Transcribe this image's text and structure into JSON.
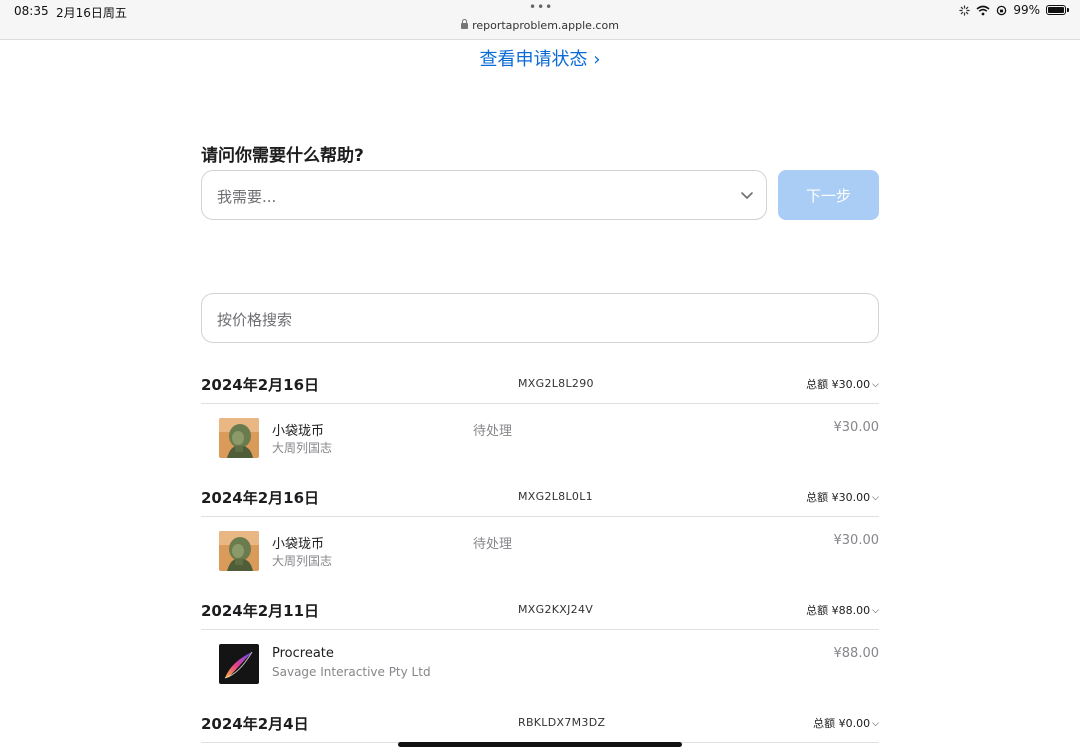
{
  "statusbar": {
    "time": "08:35",
    "date": "2月16日周五",
    "dots": "•••",
    "url": "reportaproblem.apple.com",
    "battery": "99%"
  },
  "status_link": "查看申请状态 ›",
  "help": {
    "question": "请问你需要什么帮助?",
    "select_placeholder": "我需要...",
    "next_label": "下一步"
  },
  "search": {
    "placeholder": "按价格搜索"
  },
  "orders": [
    {
      "date": "2024年2月16日",
      "order_id": "MXG2L8L290",
      "total": "总额 ¥30.00",
      "item": {
        "title": "小袋珑币",
        "subtitle": "大周列国志",
        "status": "待处理",
        "price": "¥30.00",
        "icon": "game-character-icon"
      }
    },
    {
      "date": "2024年2月16日",
      "order_id": "MXG2L8L0L1",
      "total": "总额 ¥30.00",
      "item": {
        "title": "小袋珑币",
        "subtitle": "大周列国志",
        "status": "待处理",
        "price": "¥30.00",
        "icon": "game-character-icon"
      }
    },
    {
      "date": "2024年2月11日",
      "order_id": "MXG2KXJ24V",
      "total": "总额 ¥88.00",
      "item": {
        "title": "Procreate",
        "subtitle": "Savage Interactive Pty Ltd",
        "status": "",
        "price": "¥88.00",
        "icon": "procreate-app-icon"
      }
    },
    {
      "date": "2024年2月4日",
      "order_id": "RBKLDX7M3DZ",
      "total": "总额 ¥0.00"
    }
  ],
  "colors": {
    "link": "#0a6bd6",
    "button_disabled": "#a9cdf5"
  }
}
